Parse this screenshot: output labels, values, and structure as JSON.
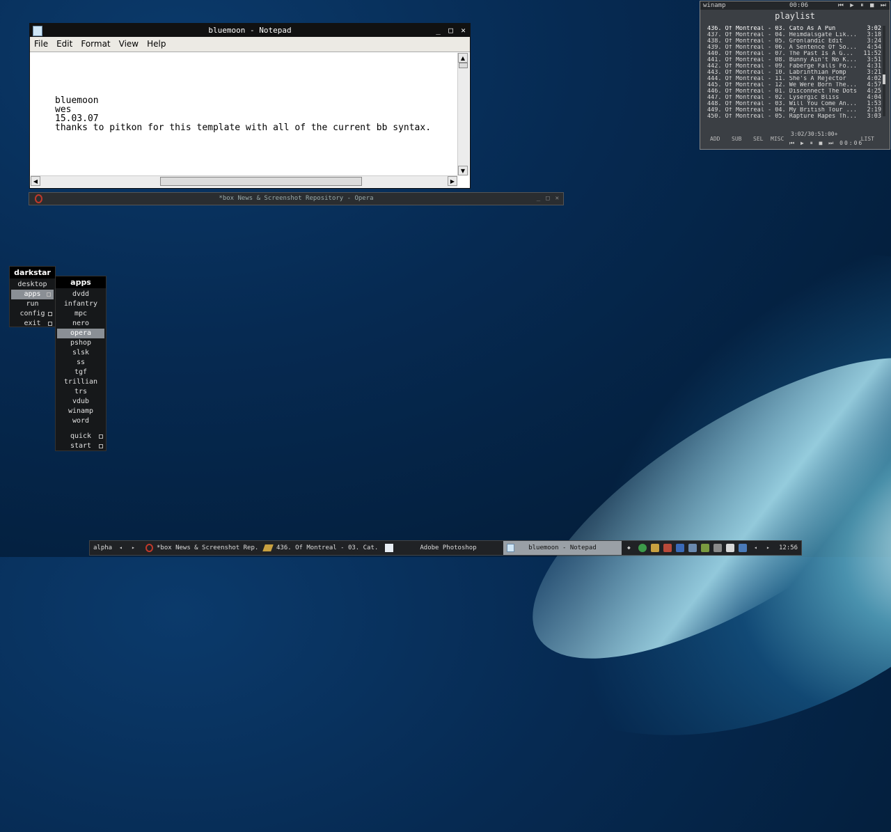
{
  "notepad": {
    "title": "bluemoon - Notepad",
    "menu": [
      "File",
      "Edit",
      "Format",
      "View",
      "Help"
    ],
    "content": "bluemoon\nwes\n15.03.07\nthanks to pitkon for this template with all of the current bb syntax.",
    "controls": {
      "min": "_",
      "max": "□",
      "close": "✕"
    }
  },
  "opera": {
    "title": "*box News & Screenshot Repository - Opera",
    "controls": {
      "min": "_",
      "max": "□",
      "close": "✕"
    }
  },
  "winamp": {
    "app_label": "winamp",
    "time_top": "00:06",
    "controls": "⏮ ▶ ⏸ ■ ⏭",
    "playlist_title": "playlist",
    "tracks": [
      {
        "text": "436. Of Montreal - 03. Cato As A Pun",
        "dur": "3:02"
      },
      {
        "text": "437. Of Montreal - 04. Heimdalsgate Lik...",
        "dur": "3:18"
      },
      {
        "text": "438. Of Montreal - 05. Gronlandic Edit",
        "dur": "3:24"
      },
      {
        "text": "439. Of Montreal - 06. A Sentence Of So...",
        "dur": "4:54"
      },
      {
        "text": "440. Of Montreal - 07. The Past Is A G...",
        "dur": "11:52"
      },
      {
        "text": "441. Of Montreal - 08. Bunny Ain't No K...",
        "dur": "3:51"
      },
      {
        "text": "442. Of Montreal - 09. Faberge Falls Fo...",
        "dur": "4:31"
      },
      {
        "text": "443. Of Montreal - 10. Labrinthian Pomp",
        "dur": "3:21"
      },
      {
        "text": "444. Of Montreal - 11. She's A Rejector",
        "dur": "4:02"
      },
      {
        "text": "445. Of Montreal - 12. We Were Born The...",
        "dur": "4:57"
      },
      {
        "text": "446. Of Montreal - 01. Disconnect The Dots",
        "dur": "4:25"
      },
      {
        "text": "447. Of Montreal - 02. Lysergic Bliss",
        "dur": "4:04"
      },
      {
        "text": "448. Of Montreal - 03. Will You Come An...",
        "dur": "1:53"
      },
      {
        "text": "449. Of Montreal - 04. My British Tour ...",
        "dur": "2:19"
      },
      {
        "text": "450. Of Montreal - 05. Rapture Rapes Th...",
        "dur": "3:03"
      }
    ],
    "total_time": "3:02/30:51:00+",
    "elapsed": "00:06",
    "buttons": {
      "add": "ADD",
      "sub": "SUB",
      "sel": "SEL",
      "misc": "MISC",
      "list": "LIST"
    }
  },
  "root_menu": {
    "title": "darkstar",
    "items": [
      "desktop",
      "apps",
      "run",
      "config",
      "exit"
    ]
  },
  "apps_menu": {
    "title": "apps",
    "items": [
      "dvdd",
      "infantry",
      "mpc",
      "nero",
      "opera",
      "pshop",
      "slsk",
      "ss",
      "tgf",
      "trillian",
      "trs",
      "vdub",
      "winamp",
      "word"
    ],
    "extra": [
      "quick",
      "start"
    ]
  },
  "taskbar": {
    "workspace": "alpha",
    "tasks": [
      "*box News & Screenshot Rep...",
      "436. Of Montreal - 03. Cat...",
      "Adobe Photoshop",
      "bluemoon - Notepad"
    ],
    "clock": "12:56",
    "prev": "◂",
    "next": "▸"
  }
}
